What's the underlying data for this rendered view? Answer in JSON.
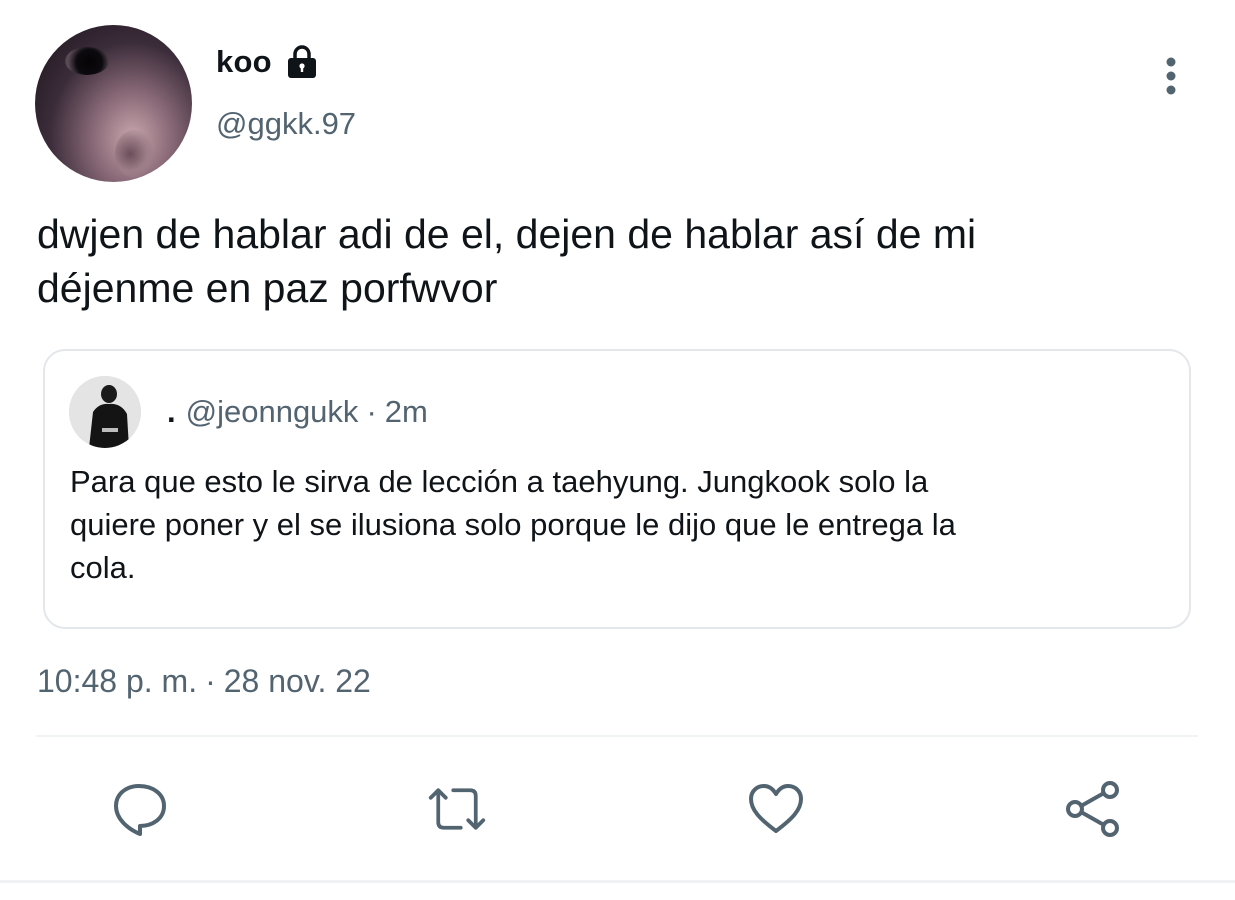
{
  "author": {
    "display_name": "koo",
    "handle": "@ggkk.97",
    "protected_icon": "lock-icon"
  },
  "tweet": {
    "text_line1": "dwjen de hablar adi de el, dejen de hablar así de mi",
    "text_line2": "déjenme en paz porfwvor",
    "time": "10:48 p. m.",
    "separator": "·",
    "date": "28 nov. 22"
  },
  "quoted": {
    "name": ".",
    "handle": "@jeonngukk",
    "separator": "·",
    "age": "2m",
    "text_line1": "Para que esto le sirva de lección a taehyung. Jungkook solo la",
    "text_line2": "quiere poner y el se ilusiona solo porque le dijo que le entrega la",
    "text_line3": "cola."
  },
  "actions": {
    "reply_icon": "reply-icon",
    "retweet_icon": "retweet-icon",
    "like_icon": "heart-icon",
    "share_icon": "share-icon"
  },
  "menu_icon": "more-vertical-icon",
  "colors": {
    "text_primary": "#0f1419",
    "text_secondary": "#536471",
    "icon": "#536471",
    "border": "#e3e7ea"
  }
}
